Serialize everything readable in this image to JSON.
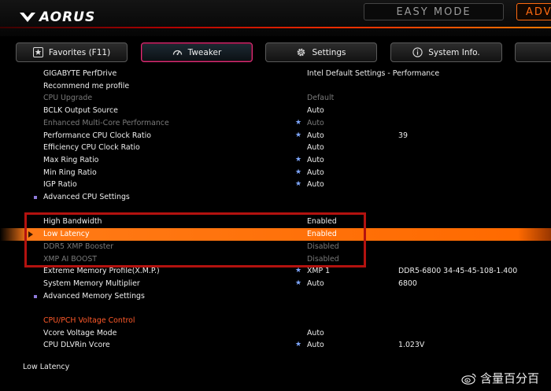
{
  "header": {
    "brand": "AORUS",
    "easy_mode": "EASY MODE",
    "adv_mode": "ADV"
  },
  "tabs": [
    {
      "label": "Favorites (F11)",
      "icon": "star-box-icon"
    },
    {
      "label": "Tweaker",
      "icon": "speedometer-icon"
    },
    {
      "label": "Settings",
      "icon": "gear-icon"
    },
    {
      "label": "System Info.",
      "icon": "info-icon"
    }
  ],
  "rows": [
    {
      "label": "GIGABYTE PerfDrive",
      "value": "Intel Default Settings - Performance"
    },
    {
      "label": "Recommend me profile",
      "value": ""
    },
    {
      "label": "CPU Upgrade",
      "value": "Default"
    },
    {
      "label": "BCLK Output Source",
      "value": "Auto"
    },
    {
      "label": "Enhanced Multi-Core Performance",
      "value": "Auto",
      "star": "★"
    },
    {
      "label": "Performance CPU Clock Ratio",
      "value": "Auto",
      "star": "★",
      "extra": "39"
    },
    {
      "label": "Efficiency CPU Clock Ratio",
      "value": "Auto"
    },
    {
      "label": "Max Ring Ratio",
      "value": "Auto",
      "star": "★"
    },
    {
      "label": "Min Ring Ratio",
      "value": "Auto",
      "star": "★"
    },
    {
      "label": "IGP Ratio",
      "value": "Auto",
      "star": "★"
    },
    {
      "label": "Advanced CPU Settings",
      "value": ""
    },
    {
      "label": "",
      "value": ""
    },
    {
      "label": "High Bandwidth",
      "value": "Enabled"
    },
    {
      "label": "Low Latency",
      "value": "Enabled"
    },
    {
      "label": "DDR5 XMP Booster",
      "value": "Disabled"
    },
    {
      "label": "XMP AI BOOST",
      "value": "Disabled"
    },
    {
      "label": "Extreme Memory Profile(X.M.P.)",
      "value": "XMP 1",
      "star": "★",
      "extra": "DDR5-6800 34-45-45-108-1.400"
    },
    {
      "label": "System Memory Multiplier",
      "value": "Auto",
      "star": "★",
      "extra": "6800"
    },
    {
      "label": "Advanced Memory Settings",
      "value": ""
    },
    {
      "label": "",
      "value": ""
    },
    {
      "label": "CPU/PCH Voltage Control",
      "value": ""
    },
    {
      "label": "Vcore Voltage Mode",
      "value": "Auto"
    },
    {
      "label": "CPU DLVRin Vcore",
      "value": "Auto",
      "star": "★",
      "extra": "1.023V"
    }
  ],
  "footer": {
    "help_text": "Low Latency"
  },
  "watermark": {
    "text": "含量百分百"
  },
  "colors": {
    "accent": "#ff6a10",
    "highlight": "#ff7a16",
    "annotation_box": "#b3120f",
    "section_title": "#ff5a2a"
  }
}
